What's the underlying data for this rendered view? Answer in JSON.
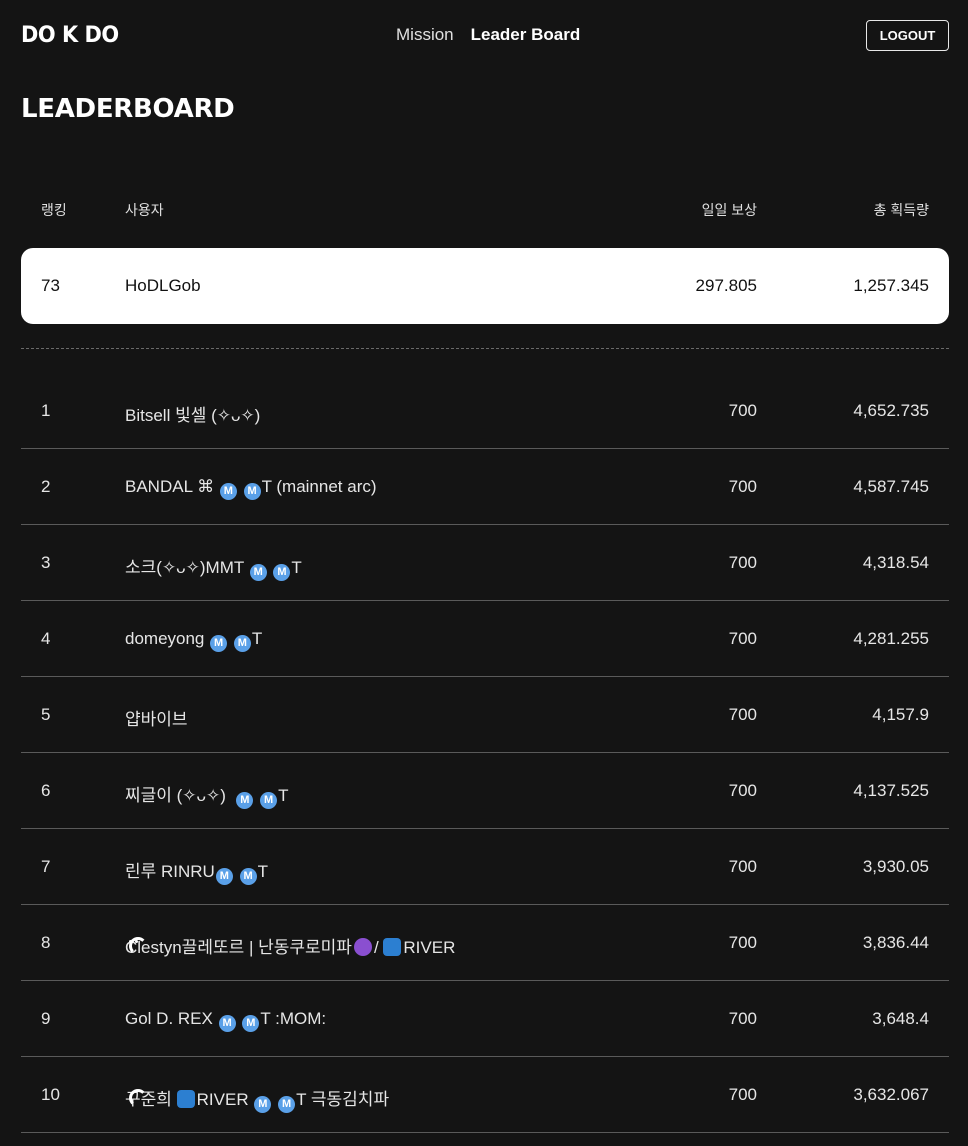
{
  "header": {
    "logo": "DO K DO",
    "nav": [
      {
        "label": "Mission",
        "active": false
      },
      {
        "label": "Leader Board",
        "active": true
      }
    ],
    "logout_label": "LOGOUT"
  },
  "page_title": "LEADERBOARD",
  "columns": {
    "rank": "랭킹",
    "user": "사용자",
    "daily": "일일 보상",
    "total": "총 획득량"
  },
  "my_row": {
    "rank": "73",
    "user": "HoDLGob",
    "daily": "297.805",
    "total": "1,257.345"
  },
  "rows": [
    {
      "rank": "1",
      "parts": [
        {
          "t": "Bitsell 빛셀 (✧ᴗ✧)"
        }
      ],
      "daily": "700",
      "total": "4,652.735"
    },
    {
      "rank": "2",
      "parts": [
        {
          "t": "BANDAL ⌘ "
        },
        {
          "badge": "M"
        },
        {
          "t": " "
        },
        {
          "badge": "M"
        },
        {
          "t": "T (mainnet arc)"
        }
      ],
      "daily": "700",
      "total": "4,587.745"
    },
    {
      "rank": "3",
      "parts": [
        {
          "t": "소크(✧ᴗ✧)MMT "
        },
        {
          "badge": "M"
        },
        {
          "t": " "
        },
        {
          "badge": "M"
        },
        {
          "t": "T"
        }
      ],
      "daily": "700",
      "total": "4,318.54"
    },
    {
      "rank": "4",
      "parts": [
        {
          "t": "domeyong "
        },
        {
          "badge": "M"
        },
        {
          "t": " "
        },
        {
          "badge": "M"
        },
        {
          "t": "T"
        }
      ],
      "daily": "700",
      "total": "4,281.255"
    },
    {
      "rank": "5",
      "parts": [
        {
          "t": "얍바이브"
        }
      ],
      "daily": "700",
      "total": "4,157.9"
    },
    {
      "rank": "6",
      "parts": [
        {
          "t": "찌글이 (✧ᴗ✧)  "
        },
        {
          "badge": "M"
        },
        {
          "t": " "
        },
        {
          "badge": "M"
        },
        {
          "t": "T"
        }
      ],
      "daily": "700",
      "total": "4,137.525"
    },
    {
      "rank": "7",
      "parts": [
        {
          "t": "린루 RINRU"
        },
        {
          "badge": "M"
        },
        {
          "t": " "
        },
        {
          "badge": "M"
        },
        {
          "t": "T"
        }
      ],
      "daily": "700",
      "total": "3,930.05"
    },
    {
      "rank": "8",
      "parts": [
        {
          "t": "Clestyn끌레또르 | 난동쿠로미파"
        },
        {
          "devil": true
        },
        {
          "t": "/ "
        },
        {
          "wave": true
        },
        {
          "t": "RIVER"
        }
      ],
      "daily": "700",
      "total": "3,836.44"
    },
    {
      "rank": "9",
      "parts": [
        {
          "t": "Gol D. REX "
        },
        {
          "badge": "M"
        },
        {
          "t": " "
        },
        {
          "badge": "M"
        },
        {
          "t": "T :MOM:"
        }
      ],
      "daily": "700",
      "total": "3,648.4"
    },
    {
      "rank": "10",
      "parts": [
        {
          "t": "구준희 "
        },
        {
          "wave": true
        },
        {
          "t": "RIVER "
        },
        {
          "badge": "M"
        },
        {
          "t": " "
        },
        {
          "badge": "M"
        },
        {
          "t": "T 극동김치파"
        }
      ],
      "daily": "700",
      "total": "3,632.067"
    }
  ],
  "colors": {
    "background": "#141414",
    "highlight_row": "#ffffff",
    "badge_blue": "#5aa0e8"
  }
}
